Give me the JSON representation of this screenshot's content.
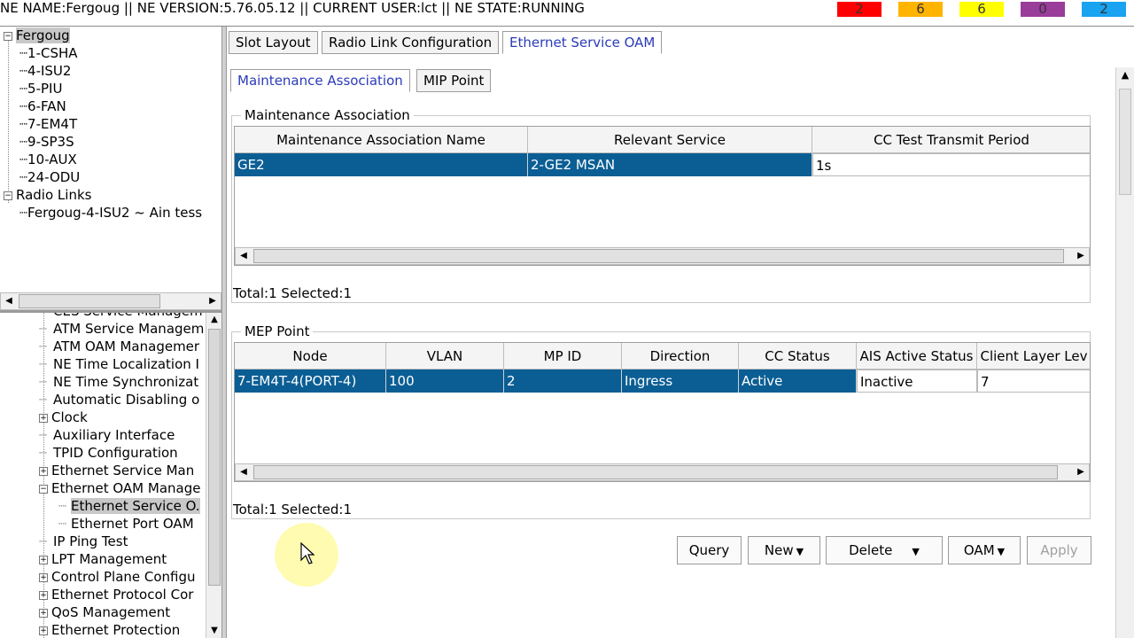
{
  "topbar": {
    "info": "NE NAME:Fergoug || NE VERSION:5.76.05.12 || CURRENT USER:lct || NE STATE:RUNNING",
    "alarms": [
      {
        "count": "2",
        "color": "#ff0000"
      },
      {
        "count": "6",
        "color": "#ffb400"
      },
      {
        "count": "6",
        "color": "#ffff00"
      },
      {
        "count": "0",
        "color": "#9a3c9a"
      },
      {
        "count": "2",
        "color": "#19a3f0"
      }
    ]
  },
  "tree": {
    "root": "Fergoug",
    "boards": [
      "1-CSHA",
      "4-ISU2",
      "5-PIU",
      "6-FAN",
      "7-EM4T",
      "9-SP3S",
      "10-AUX",
      "24-ODU"
    ],
    "radio_links": "Radio Links",
    "radio_link_item": "Fergoug-4-ISU2 ~ Ain tess",
    "toggle_minus": "−",
    "toggle_plus": "+"
  },
  "function_tree": {
    "items": [
      {
        "label": "CES Service Managem",
        "toggle": ""
      },
      {
        "label": "ATM Service Managem",
        "toggle": ""
      },
      {
        "label": "ATM OAM Managemer",
        "toggle": ""
      },
      {
        "label": "NE Time Localization I",
        "toggle": ""
      },
      {
        "label": "NE Time Synchronizat",
        "toggle": ""
      },
      {
        "label": "Automatic Disabling o",
        "toggle": ""
      },
      {
        "label": "Clock",
        "toggle": "+"
      },
      {
        "label": "Auxiliary Interface",
        "toggle": ""
      },
      {
        "label": "TPID Configuration",
        "toggle": ""
      },
      {
        "label": "Ethernet Service Man",
        "toggle": "+"
      },
      {
        "label": "Ethernet OAM Manage",
        "toggle": "−"
      },
      {
        "label": "Ethernet Service O.",
        "toggle": "",
        "child": true,
        "selected": true
      },
      {
        "label": "Ethernet Port OAM",
        "toggle": "",
        "child": true
      },
      {
        "label": "IP Ping Test",
        "toggle": ""
      },
      {
        "label": "LPT Management",
        "toggle": "+"
      },
      {
        "label": "Control Plane Configu",
        "toggle": "+"
      },
      {
        "label": "Ethernet Protocol Cor",
        "toggle": "+"
      },
      {
        "label": "QoS Management",
        "toggle": "+"
      },
      {
        "label": "Ethernet Protection",
        "toggle": "+"
      }
    ]
  },
  "tabs": {
    "top": [
      "Slot Layout",
      "Radio Link Configuration",
      "Ethernet Service OAM"
    ],
    "sub": [
      "Maintenance Association",
      "MIP Point"
    ]
  },
  "ma_section": {
    "legend": "Maintenance Association",
    "columns": [
      "Maintenance Association Name",
      "Relevant Service",
      "CC Test Transmit Period"
    ],
    "rows": [
      [
        "GE2",
        "2-GE2 MSAN",
        "1s"
      ]
    ],
    "summary": "Total:1 Selected:1"
  },
  "mep_section": {
    "legend": "MEP Point",
    "columns": [
      "Node",
      "VLAN",
      "MP ID",
      "Direction",
      "CC Status",
      "AIS Active Status",
      "Client Layer Lev"
    ],
    "rows": [
      [
        "7-EM4T-4(PORT-4)",
        "100",
        "2",
        "Ingress",
        "Active",
        "Inactive",
        "7"
      ]
    ],
    "summary": "Total:1 Selected:1"
  },
  "buttons": {
    "query": "Query",
    "new": "New",
    "delete": "Delete",
    "oam": "OAM",
    "apply": "Apply"
  }
}
